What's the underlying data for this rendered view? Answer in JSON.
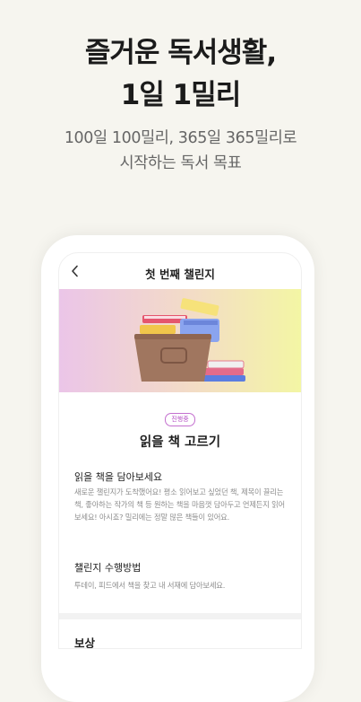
{
  "hero": {
    "title_line1": "즐거운 독서생활,",
    "title_line2": "1일 1밀리",
    "subtitle_line1": "100일 100밀리, 365일 365밀리로",
    "subtitle_line2": "시작하는 독서 목표"
  },
  "screen": {
    "header": {
      "title": "첫 번째 챌린지",
      "back_icon": "chevron-left-icon"
    },
    "banner": {
      "illustration": "books-in-basket-illustration",
      "colors": {
        "gradient_start": "#ebc5e8",
        "gradient_end": "#f3f6a4"
      }
    },
    "status_badge": "진행중",
    "challenge_title": "읽을 책 고르기",
    "sections": [
      {
        "heading": "읽을 책을 담아보세요",
        "description": "새로운 챌린지가 도착했어요! 평소 읽어보고 싶었던 책, 제목이 끌리는 책, 좋아하는 작가의 책 등 원하는 책을 마음껏 담아두고 언제든지 읽어보세요! 아시죠? 밀리에는 정말 많은 책들이 있어요."
      },
      {
        "heading": "챌린지 수행방법",
        "description": "투데이, 피드에서 책을 찾고 내 서재에 담아보세요."
      }
    ],
    "reward_heading": "보상"
  },
  "colors": {
    "background": "#f6f5ef",
    "accent": "#b44dc4"
  }
}
